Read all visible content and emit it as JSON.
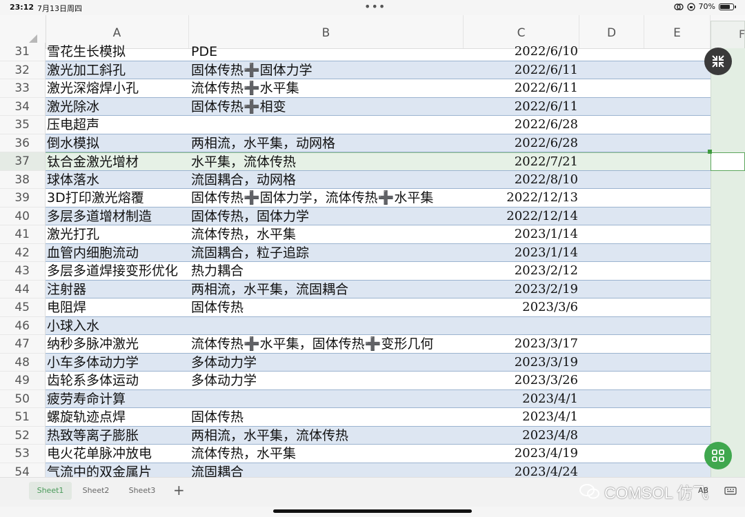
{
  "status": {
    "time": "23:12",
    "date": "7月13日周四",
    "battery": "70%"
  },
  "columns": [
    "A",
    "B",
    "C",
    "D",
    "E",
    "F"
  ],
  "rows": [
    {
      "n": "31",
      "a": "雪花生长模拟",
      "b": "PDE",
      "c": "2022/6/10"
    },
    {
      "n": "32",
      "a": "激光加工斜孔",
      "b": "固体传热➕固体力学",
      "c": "2022/6/11"
    },
    {
      "n": "33",
      "a": "激光深熔焊小孔",
      "b": "流体传热➕水平集",
      "c": "2022/6/11"
    },
    {
      "n": "34",
      "a": "激光除冰",
      "b": "固体传热➕相变",
      "c": "2022/6/11"
    },
    {
      "n": "35",
      "a": "压电超声",
      "b": "",
      "c": "2022/6/28"
    },
    {
      "n": "36",
      "a": "倒水模拟",
      "b": "两相流，水平集，动网格",
      "c": "2022/6/28"
    },
    {
      "n": "37",
      "a": "钛合金激光增材",
      "b": "水平集，流体传热",
      "c": "2022/7/21"
    },
    {
      "n": "38",
      "a": "球体落水",
      "b": "流固耦合，动网格",
      "c": "2022/8/10"
    },
    {
      "n": "39",
      "a": "3D打印激光熔覆",
      "b": "固体传热➕固体力学，流体传热➕水平集",
      "c": "2022/12/13"
    },
    {
      "n": "40",
      "a": "多层多道增材制造",
      "b": "固体传热，固体力学",
      "c": "2022/12/14"
    },
    {
      "n": "41",
      "a": "激光打孔",
      "b": "流体传热，水平集",
      "c": "2023/1/14"
    },
    {
      "n": "42",
      "a": "血管内细胞流动",
      "b": "流固耦合，粒子追踪",
      "c": "2023/1/14"
    },
    {
      "n": "43",
      "a": "多层多道焊接变形优化",
      "b": "热力耦合",
      "c": "2023/2/12"
    },
    {
      "n": "44",
      "a": "注射器",
      "b": "两相流，水平集，流固耦合",
      "c": "2023/2/19"
    },
    {
      "n": "45",
      "a": "电阻焊",
      "b": "固体传热",
      "c": "2023/3/6"
    },
    {
      "n": "46",
      "a": "小球入水",
      "b": "",
      "c": ""
    },
    {
      "n": "47",
      "a": "纳秒多脉冲激光",
      "b": "流体传热➕水平集，固体传热➕变形几何",
      "c": "2023/3/17"
    },
    {
      "n": "48",
      "a": "小车多体动力学",
      "b": "多体动力学",
      "c": "2023/3/19"
    },
    {
      "n": "49",
      "a": "齿轮系多体运动",
      "b": "多体动力学",
      "c": "2023/3/26"
    },
    {
      "n": "50",
      "a": "疲劳寿命计算",
      "b": "",
      "c": "2023/4/1"
    },
    {
      "n": "51",
      "a": "螺旋轨迹点焊",
      "b": "固体传热",
      "c": "2023/4/1"
    },
    {
      "n": "52",
      "a": "热致等离子膨胀",
      "b": "两相流，水平集，流体传热",
      "c": "2023/4/8"
    },
    {
      "n": "53",
      "a": "电火花单脉冲放电",
      "b": "流体传热，水平集",
      "c": "2023/4/19"
    },
    {
      "n": "54",
      "a": "气流中的双金属片",
      "b": "流固耦合",
      "c": "2023/4/24"
    }
  ],
  "selected_row": "37",
  "tabs": [
    "Sheet1",
    "Sheet2",
    "Sheet3"
  ],
  "add_tab": "+",
  "watermark": "COMSOL 仿飞",
  "ab_label": "AB"
}
